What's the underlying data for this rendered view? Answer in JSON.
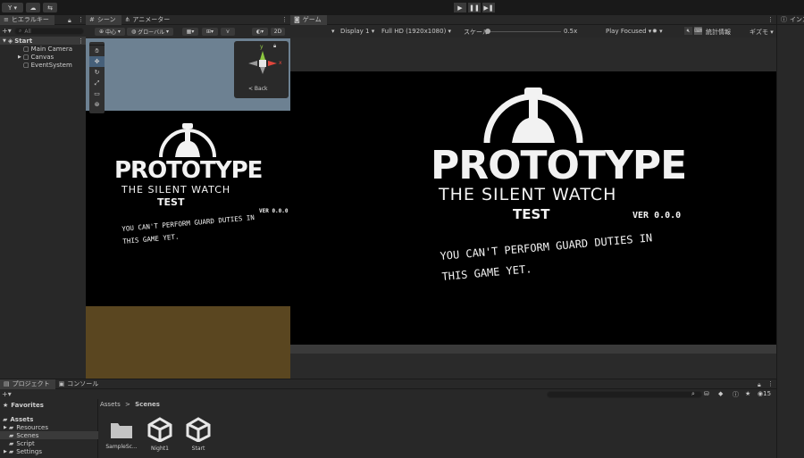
{
  "toolbar": {
    "account_label": "Y",
    "play_icon": "play-icon",
    "pause_icon": "pause-icon",
    "step_icon": "step-icon"
  },
  "hierarchy": {
    "tab_label": "ヒエラルキー",
    "search_placeholder": "All",
    "scene_name": "Start",
    "items": [
      "Main Camera",
      "Canvas",
      "EventSystem"
    ]
  },
  "scene": {
    "tab_label": "シーン",
    "animator_tab_label": "アニメーター",
    "pivot_label": "中心",
    "global_label": "グローバル",
    "mode_2d_label": "2D",
    "back_label": "< Back",
    "axis_x_label": "x",
    "axis_y_label": "y"
  },
  "game": {
    "tab_label": "ゲーム",
    "display_label": "Display 1",
    "resolution_label": "Full HD (1920x1080)",
    "scale_label": "スケール",
    "scale_value": "0.5x",
    "play_mode_label": "Play Focused",
    "stats_label": "統計情報",
    "gizmos_label": "ギズモ"
  },
  "inspector": {
    "tab_label": "インスペクター"
  },
  "splash": {
    "title": "PROTOTYPE",
    "subtitle": "THE SILENT WATCH",
    "test_label": "TEST",
    "version": "VER 0.0.0",
    "message_line1": "YOU CAN'T PERFORM GUARD DUTIES IN",
    "message_line2": "THIS GAME YET."
  },
  "project": {
    "tab_label": "プロジェクト",
    "console_tab_label": "コンソール",
    "favorites_label": "Favorites",
    "assets_label": "Assets",
    "folders": [
      "Resources",
      "Scenes",
      "Script",
      "Settings"
    ],
    "breadcrumb": [
      "Assets",
      "Scenes"
    ],
    "breadcrumb_sep": ">",
    "items": [
      "SampleSc...",
      "Night1",
      "Start"
    ],
    "visible_count": "15"
  },
  "colors": {
    "bg": "#191919",
    "panel": "#282828",
    "selected_row": "#3a3a3a",
    "scene_sky": "#6d8192",
    "scene_ground": "#5a4620",
    "game_black": "#000000"
  }
}
